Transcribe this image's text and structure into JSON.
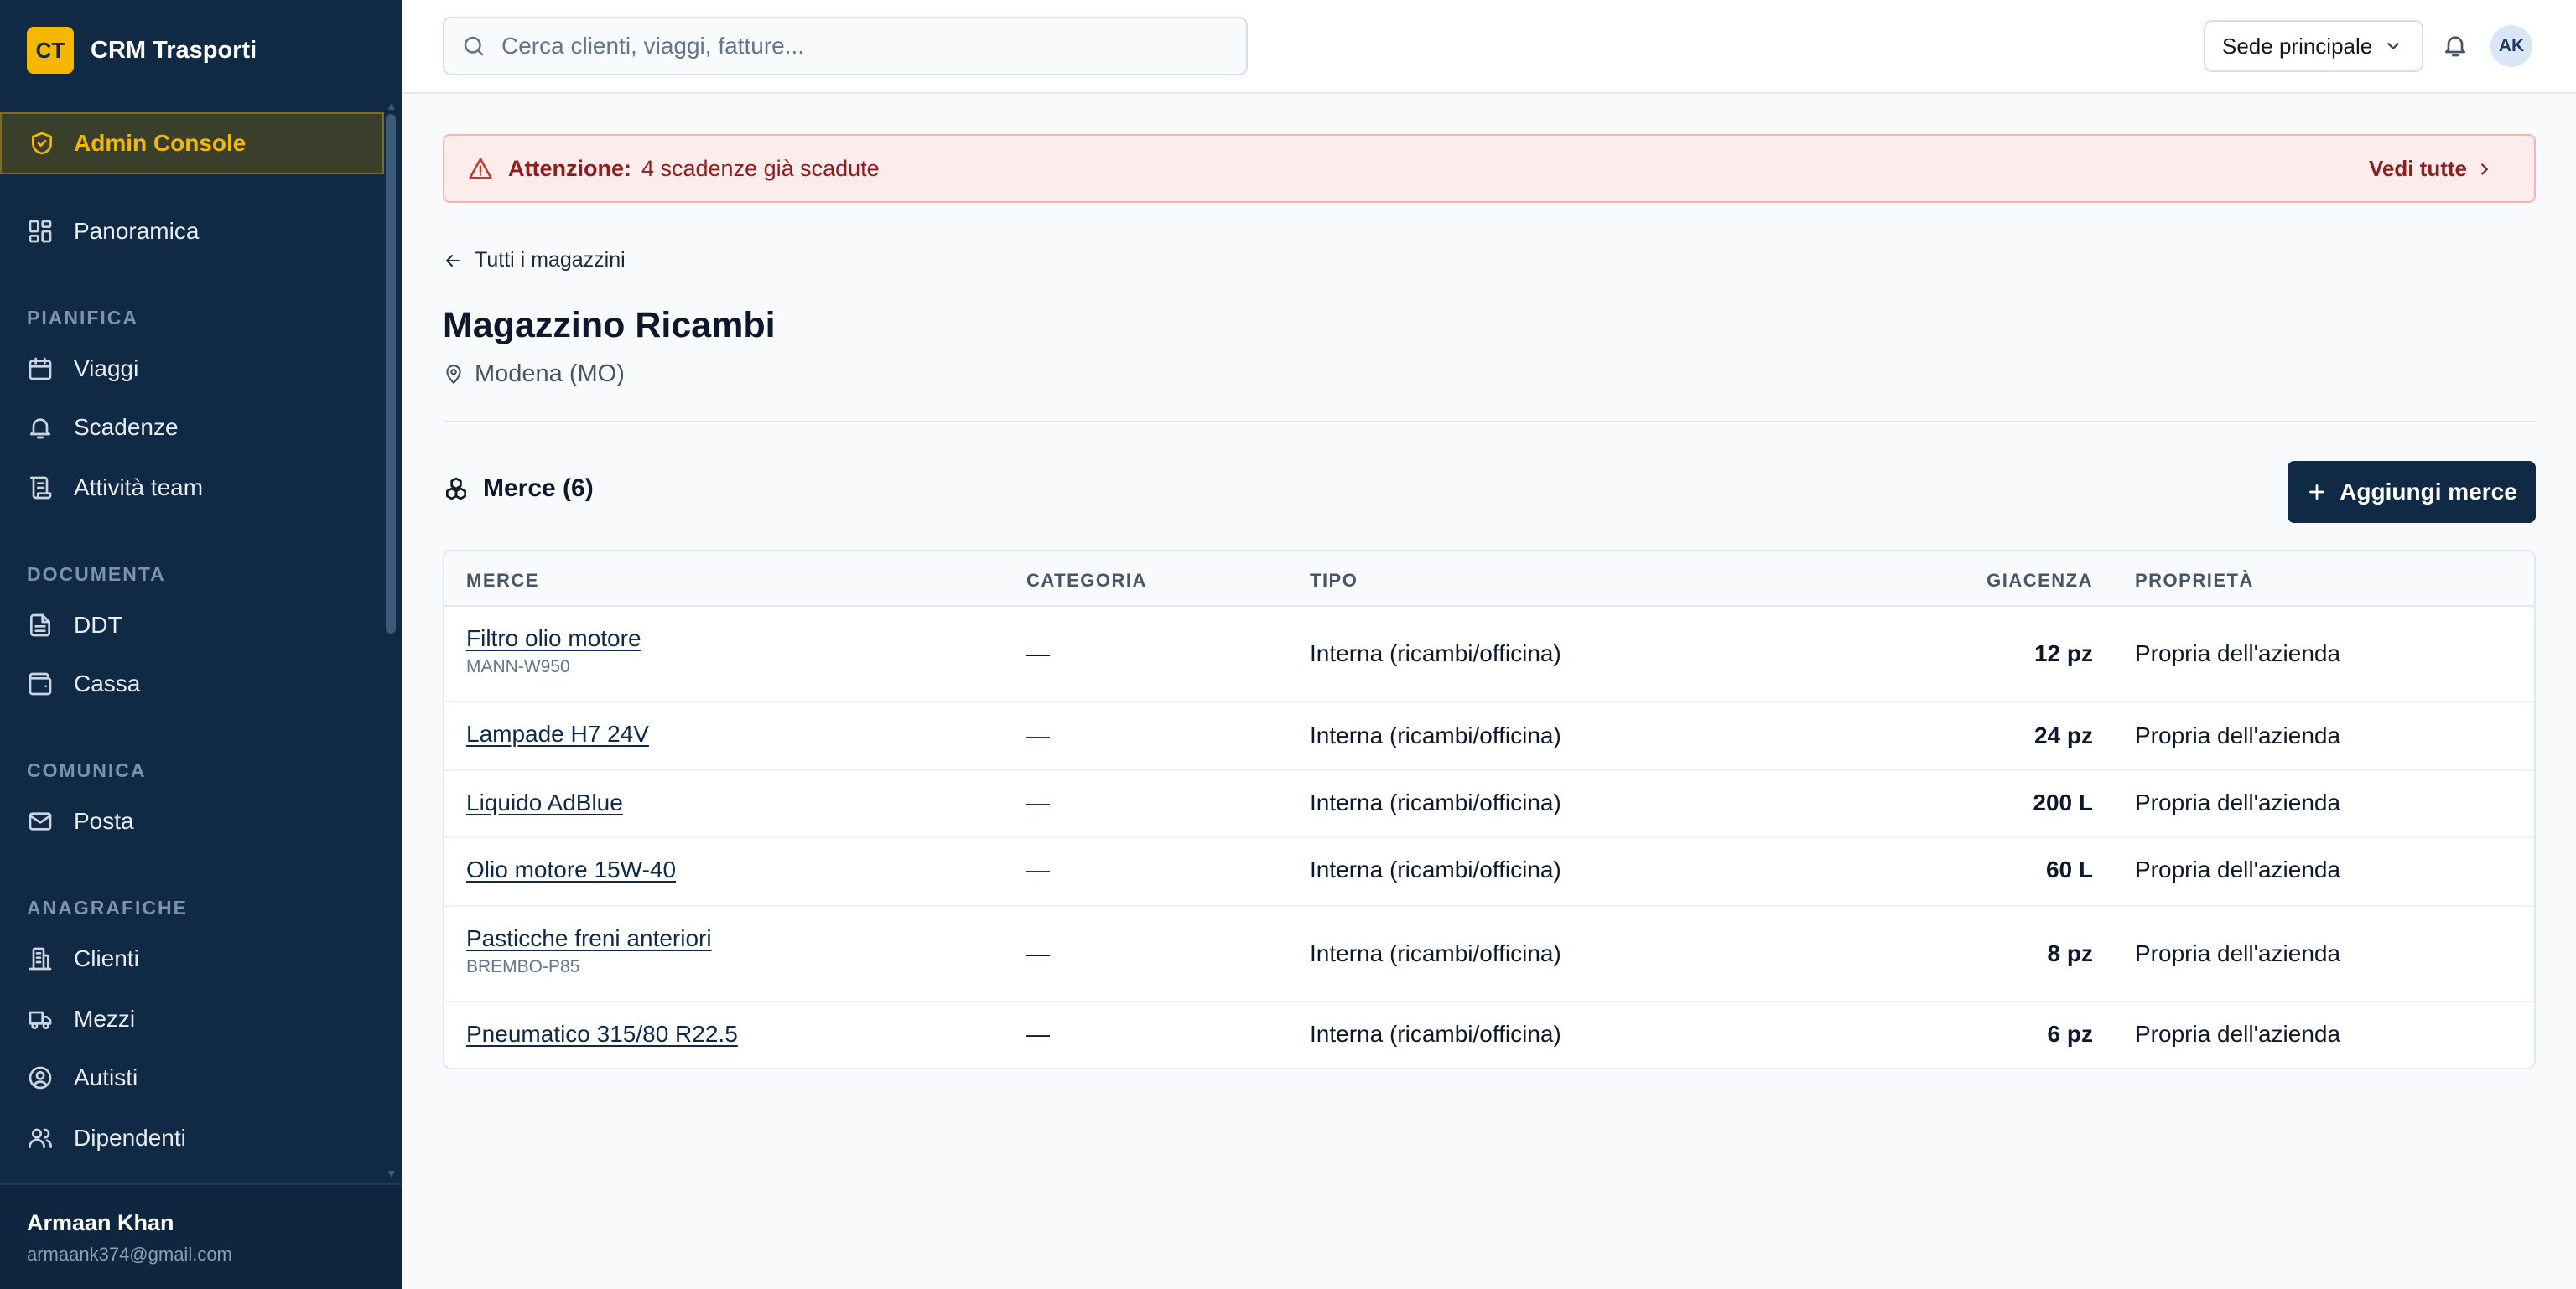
{
  "brand": {
    "logo": "CT",
    "name": "CRM Trasporti"
  },
  "sidebar": {
    "admin": "Admin Console",
    "overview": "Panoramica",
    "sections": [
      {
        "label": "PIANIFICA",
        "items": [
          "Viaggi",
          "Scadenze",
          "Attività team"
        ]
      },
      {
        "label": "DOCUMENTA",
        "items": [
          "DDT",
          "Cassa"
        ]
      },
      {
        "label": "COMUNICA",
        "items": [
          "Posta"
        ]
      },
      {
        "label": "ANAGRAFICHE",
        "items": [
          "Clienti",
          "Mezzi",
          "Autisti",
          "Dipendenti"
        ]
      }
    ],
    "user": {
      "name": "Armaan Khan",
      "email": "armaank374@gmail.com"
    }
  },
  "topbar": {
    "search_placeholder": "Cerca clienti, viaggi, fatture...",
    "site_select": "Sede principale",
    "avatar": "AK"
  },
  "alert": {
    "label": "Attenzione:",
    "text": "4 scadenze già scadute",
    "link": "Vedi tutte"
  },
  "page": {
    "back": "Tutti i magazzini",
    "title": "Magazzino Ricambi",
    "location": "Modena (MO)",
    "section_title": "Merce (6)",
    "add_button": "Aggiungi merce"
  },
  "table": {
    "headers": [
      "MERCE",
      "CATEGORIA",
      "TIPO",
      "GIACENZA",
      "PROPRIETÀ"
    ],
    "rows": [
      {
        "name": "Filtro olio motore",
        "code": "MANN-W950",
        "category": "—",
        "type": "Interna (ricambi/officina)",
        "stock": "12 pz",
        "owner": "Propria dell'azienda"
      },
      {
        "name": "Lampade H7 24V",
        "code": "",
        "category": "—",
        "type": "Interna (ricambi/officina)",
        "stock": "24 pz",
        "owner": "Propria dell'azienda"
      },
      {
        "name": "Liquido AdBlue",
        "code": "",
        "category": "—",
        "type": "Interna (ricambi/officina)",
        "stock": "200 L",
        "owner": "Propria dell'azienda"
      },
      {
        "name": "Olio motore 15W-40",
        "code": "",
        "category": "—",
        "type": "Interna (ricambi/officina)",
        "stock": "60 L",
        "owner": "Propria dell'azienda"
      },
      {
        "name": "Pasticche freni anteriori",
        "code": "BREMBO-P85",
        "category": "—",
        "type": "Interna (ricambi/officina)",
        "stock": "8 pz",
        "owner": "Propria dell'azienda"
      },
      {
        "name": "Pneumatico 315/80 R22.5",
        "code": "",
        "category": "—",
        "type": "Interna (ricambi/officina)",
        "stock": "6 pz",
        "owner": "Propria dell'azienda"
      }
    ]
  },
  "colors": {
    "sidebar_bg": "#102a45",
    "accent": "#f5b700",
    "alert_bg": "#fdecec",
    "alert_text": "#8f1d1d",
    "primary_button": "#102a45"
  }
}
